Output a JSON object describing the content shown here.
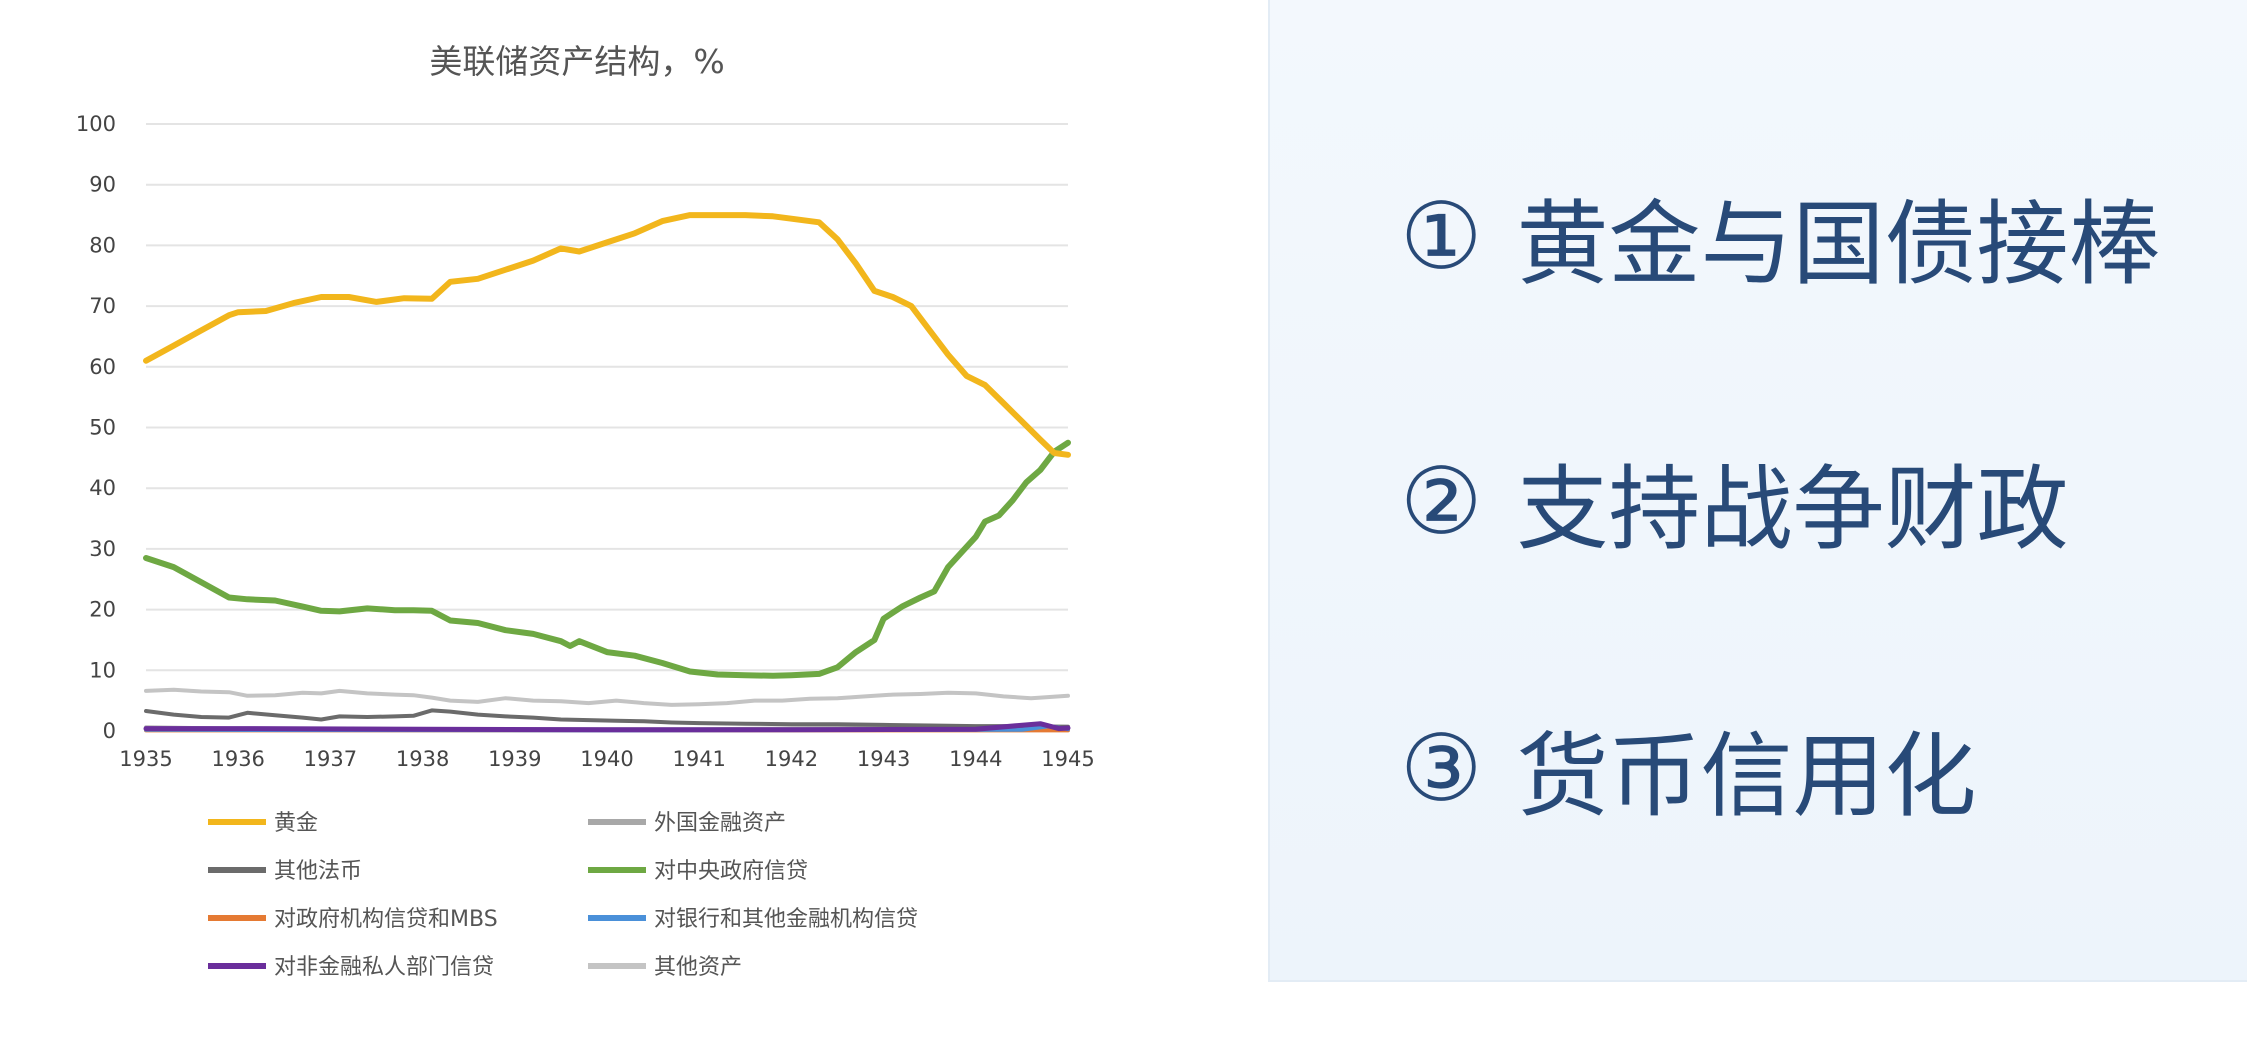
{
  "chart_data": {
    "type": "line",
    "title": "美联储资产结构，%",
    "x_ticks": [
      "1935",
      "1936",
      "1937",
      "1938",
      "1939",
      "1940",
      "1941",
      "1942",
      "1943",
      "1944",
      "1945"
    ],
    "xlim": [
      1935,
      1945
    ],
    "ylim": [
      0,
      100
    ],
    "y_ticks": [
      0,
      10,
      20,
      30,
      40,
      50,
      60,
      70,
      80,
      90,
      100
    ],
    "grid": true,
    "legend_position": "bottom",
    "series": [
      {
        "name": "黄金",
        "color": "#f2b61c",
        "points": [
          [
            1935,
            61
          ],
          [
            1935.3,
            63.5
          ],
          [
            1935.6,
            66
          ],
          [
            1935.9,
            68.5
          ],
          [
            1936,
            69
          ],
          [
            1936.3,
            69.2
          ],
          [
            1936.6,
            70.5
          ],
          [
            1936.9,
            71.5
          ],
          [
            1937.2,
            71.5
          ],
          [
            1937.5,
            70.7
          ],
          [
            1937.8,
            71.3
          ],
          [
            1938.1,
            71.2
          ],
          [
            1938.3,
            74
          ],
          [
            1938.6,
            74.5
          ],
          [
            1938.9,
            76
          ],
          [
            1939.2,
            77.5
          ],
          [
            1939.5,
            79.5
          ],
          [
            1939.7,
            79
          ],
          [
            1940,
            80.5
          ],
          [
            1940.3,
            82
          ],
          [
            1940.6,
            84
          ],
          [
            1940.9,
            85
          ],
          [
            1941.2,
            85
          ],
          [
            1941.5,
            85
          ],
          [
            1941.8,
            84.8
          ],
          [
            1942.0,
            84.4
          ],
          [
            1942.3,
            83.8
          ],
          [
            1942.5,
            81
          ],
          [
            1942.7,
            77
          ],
          [
            1942.9,
            72.5
          ],
          [
            1943.1,
            71.5
          ],
          [
            1943.3,
            70
          ],
          [
            1943.5,
            66
          ],
          [
            1943.7,
            62
          ],
          [
            1943.9,
            58.5
          ],
          [
            1944.1,
            57
          ],
          [
            1944.3,
            54
          ],
          [
            1944.5,
            51
          ],
          [
            1944.7,
            48
          ],
          [
            1944.85,
            45.8
          ],
          [
            1945,
            45.5
          ]
        ]
      },
      {
        "name": "外国金融资产",
        "color": "#a8a8a8",
        "points": [
          [
            1935,
            0.6
          ],
          [
            1935.5,
            0.5
          ],
          [
            1936,
            0.4
          ],
          [
            1937,
            0.4
          ],
          [
            1938,
            0.3
          ],
          [
            1939,
            0.3
          ],
          [
            1940,
            0.3
          ],
          [
            1941,
            0.3
          ],
          [
            1942,
            0.4
          ],
          [
            1943,
            0.5
          ],
          [
            1944,
            0.6
          ],
          [
            1945,
            0.7
          ]
        ]
      },
      {
        "name": "其他法币",
        "color": "#6b6b6b",
        "points": [
          [
            1935,
            3.3
          ],
          [
            1935.3,
            2.7
          ],
          [
            1935.6,
            2.3
          ],
          [
            1935.9,
            2.2
          ],
          [
            1936.1,
            3.0
          ],
          [
            1936.4,
            2.6
          ],
          [
            1936.7,
            2.2
          ],
          [
            1936.9,
            1.9
          ],
          [
            1937.1,
            2.4
          ],
          [
            1937.4,
            2.3
          ],
          [
            1937.7,
            2.4
          ],
          [
            1937.9,
            2.5
          ],
          [
            1938.1,
            3.4
          ],
          [
            1938.3,
            3.2
          ],
          [
            1938.6,
            2.7
          ],
          [
            1938.9,
            2.4
          ],
          [
            1939.2,
            2.2
          ],
          [
            1939.5,
            1.9
          ],
          [
            1939.8,
            1.8
          ],
          [
            1940.1,
            1.7
          ],
          [
            1940.4,
            1.6
          ],
          [
            1940.7,
            1.4
          ],
          [
            1941,
            1.3
          ],
          [
            1941.5,
            1.2
          ],
          [
            1942,
            1.1
          ],
          [
            1942.5,
            1.1
          ],
          [
            1943,
            1.0
          ],
          [
            1943.5,
            0.9
          ],
          [
            1944,
            0.8
          ],
          [
            1944.5,
            0.8
          ],
          [
            1945,
            0.7
          ]
        ]
      },
      {
        "name": "对中央政府信贷",
        "color": "#6ea843",
        "points": [
          [
            1935,
            28.5
          ],
          [
            1935.3,
            27
          ],
          [
            1935.6,
            24.5
          ],
          [
            1935.9,
            22
          ],
          [
            1936.1,
            21.7
          ],
          [
            1936.4,
            21.5
          ],
          [
            1936.7,
            20.5
          ],
          [
            1936.9,
            19.8
          ],
          [
            1937.1,
            19.7
          ],
          [
            1937.4,
            20.2
          ],
          [
            1937.7,
            19.9
          ],
          [
            1937.9,
            19.9
          ],
          [
            1938.1,
            19.8
          ],
          [
            1938.3,
            18.2
          ],
          [
            1938.6,
            17.8
          ],
          [
            1938.9,
            16.6
          ],
          [
            1939.2,
            16
          ],
          [
            1939.5,
            14.8
          ],
          [
            1939.6,
            14
          ],
          [
            1939.7,
            14.8
          ],
          [
            1940,
            13
          ],
          [
            1940.3,
            12.4
          ],
          [
            1940.6,
            11.2
          ],
          [
            1940.9,
            9.8
          ],
          [
            1941.2,
            9.3
          ],
          [
            1941.5,
            9.2
          ],
          [
            1941.8,
            9.1
          ],
          [
            1942.0,
            9.2
          ],
          [
            1942.3,
            9.4
          ],
          [
            1942.5,
            10.5
          ],
          [
            1942.7,
            13
          ],
          [
            1942.9,
            15
          ],
          [
            1943.0,
            18.5
          ],
          [
            1943.2,
            20.5
          ],
          [
            1943.4,
            22
          ],
          [
            1943.55,
            23
          ],
          [
            1943.7,
            27
          ],
          [
            1943.85,
            29.5
          ],
          [
            1944.0,
            32
          ],
          [
            1944.1,
            34.5
          ],
          [
            1944.25,
            35.5
          ],
          [
            1944.4,
            38
          ],
          [
            1944.55,
            41
          ],
          [
            1944.7,
            43
          ],
          [
            1944.85,
            46
          ],
          [
            1945,
            47.5
          ]
        ]
      },
      {
        "name": "对政府机构信贷和MBS",
        "color": "#e57a33",
        "points": [
          [
            1935,
            0.1
          ],
          [
            1945,
            0.1
          ]
        ]
      },
      {
        "name": "对银行和其他金融机构信贷",
        "color": "#4a90d9",
        "points": [
          [
            1935,
            0.2
          ],
          [
            1940,
            0.1
          ],
          [
            1944.5,
            0.2
          ],
          [
            1944.8,
            0.8
          ],
          [
            1945,
            0.3
          ]
        ]
      },
      {
        "name": "对非金融私人部门信贷",
        "color": "#6a2e9b",
        "points": [
          [
            1935,
            0.4
          ],
          [
            1936,
            0.4
          ],
          [
            1938,
            0.3
          ],
          [
            1940,
            0.2
          ],
          [
            1942,
            0.2
          ],
          [
            1944,
            0.3
          ],
          [
            1944.7,
            1.2
          ],
          [
            1944.9,
            0.4
          ],
          [
            1945,
            0.5
          ]
        ]
      },
      {
        "name": "其他资产",
        "color": "#c4c4c4",
        "points": [
          [
            1935,
            6.6
          ],
          [
            1935.3,
            6.8
          ],
          [
            1935.6,
            6.5
          ],
          [
            1935.9,
            6.4
          ],
          [
            1936.1,
            5.8
          ],
          [
            1936.4,
            5.9
          ],
          [
            1936.7,
            6.3
          ],
          [
            1936.9,
            6.2
          ],
          [
            1937.1,
            6.6
          ],
          [
            1937.4,
            6.2
          ],
          [
            1937.7,
            6.0
          ],
          [
            1937.9,
            5.9
          ],
          [
            1938.1,
            5.5
          ],
          [
            1938.3,
            5.0
          ],
          [
            1938.6,
            4.8
          ],
          [
            1938.9,
            5.4
          ],
          [
            1939.2,
            5.0
          ],
          [
            1939.5,
            4.9
          ],
          [
            1939.8,
            4.6
          ],
          [
            1940.1,
            5.0
          ],
          [
            1940.4,
            4.6
          ],
          [
            1940.7,
            4.3
          ],
          [
            1941,
            4.4
          ],
          [
            1941.3,
            4.6
          ],
          [
            1941.6,
            5.0
          ],
          [
            1941.9,
            5.0
          ],
          [
            1942.2,
            5.3
          ],
          [
            1942.5,
            5.4
          ],
          [
            1942.8,
            5.7
          ],
          [
            1943.1,
            6.0
          ],
          [
            1943.4,
            6.1
          ],
          [
            1943.7,
            6.3
          ],
          [
            1944.0,
            6.2
          ],
          [
            1944.3,
            5.7
          ],
          [
            1944.6,
            5.4
          ],
          [
            1944.8,
            5.6
          ],
          [
            1945,
            5.8
          ]
        ]
      }
    ],
    "legend_order": [
      [
        "黄金",
        "外国金融资产"
      ],
      [
        "其他法币",
        "对中央政府信贷"
      ],
      [
        "对政府机构信贷和MBS",
        "对银行和其他金融机构信贷"
      ],
      [
        "对非金融私人部门信贷",
        "其他资产"
      ]
    ]
  },
  "side_panel": {
    "items": [
      {
        "num": "①",
        "text": "黄金与国债接棒"
      },
      {
        "num": "②",
        "text": "支持战争财政"
      },
      {
        "num": "③",
        "text": "货币信用化"
      }
    ]
  }
}
